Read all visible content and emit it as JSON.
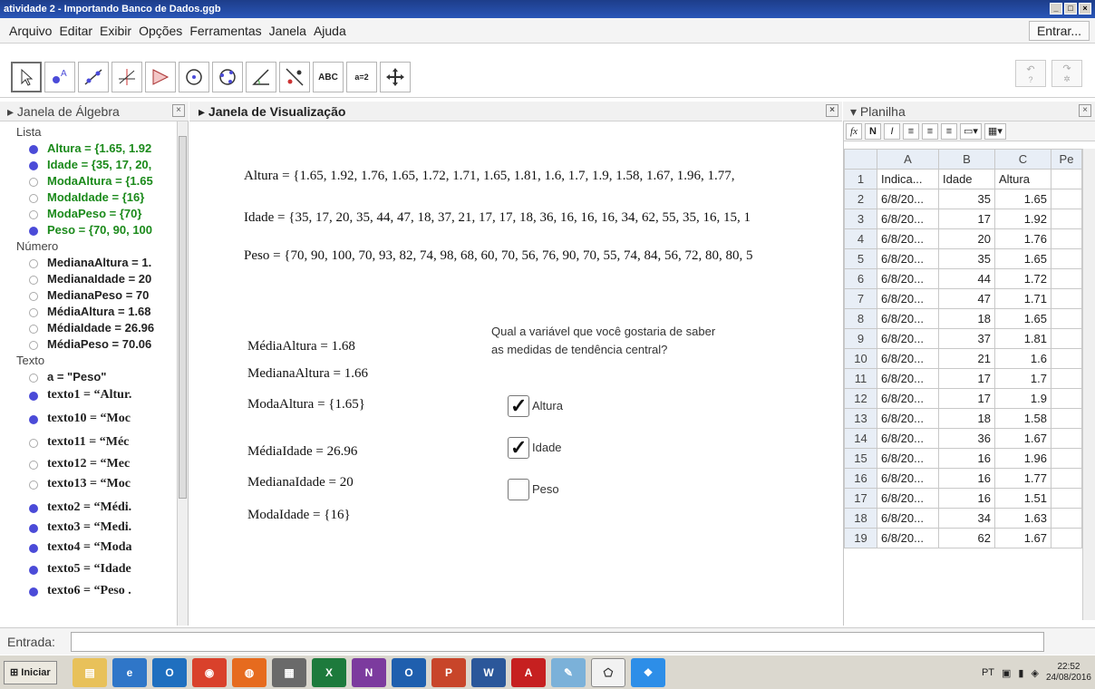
{
  "window": {
    "title": "atividade 2 - Importando Banco de Dados.ggb"
  },
  "menu": {
    "items": [
      "Arquivo",
      "Editar",
      "Exibir",
      "Opções",
      "Ferramentas",
      "Janela",
      "Ajuda"
    ],
    "signin": "Entrar..."
  },
  "toolbar": {
    "tools": [
      "move-tool-icon",
      "point-tool-icon",
      "line-tool-icon",
      "perpendicular-tool-icon",
      "polygon-tool-icon",
      "circle-tool-icon",
      "conic-tool-icon",
      "angle-tool-icon",
      "reflect-tool-icon",
      "text-tool-icon",
      "slider-tool-icon",
      "move-view-tool-icon"
    ],
    "text_label": "ABC",
    "slider_label": "a=2"
  },
  "panels": {
    "algebra_title": "Janela de Álgebra",
    "graphics_title": "Janela de Visualização",
    "sheet_title": "Planilha"
  },
  "algebra": {
    "cat_list": "Lista",
    "cat_number": "Número",
    "cat_text": "Texto",
    "lista": [
      "Altura = {1.65, 1.92",
      "Idade = {35, 17, 20,",
      "ModaAltura = {1.65",
      "ModaIdade = {16}",
      "ModaPeso = {70}",
      "Peso = {70, 90, 100"
    ],
    "numero": [
      "MedianaAltura = 1.",
      "MedianaIdade = 20",
      "MedianaPeso = 70",
      "MédiaAltura = 1.68",
      "MédiaIdade = 26.96",
      "MédiaPeso = 70.06"
    ],
    "texto": [
      "a = \"Peso\"",
      "texto1  =  “Altur.",
      "texto10  =  “Moc",
      "texto11  =  “Méc",
      "texto12  =  “Mec",
      "texto13  =  “Moc",
      "texto2  =  “Médi.",
      "texto3  =  “Medi.",
      "texto4  =  “Moda",
      "texto5  =  “Idade",
      "texto6  =  “Peso ."
    ]
  },
  "graphics": {
    "altura_list": "Altura  =  {1.65, 1.92, 1.76, 1.65, 1.72, 1.71, 1.65, 1.81, 1.6, 1.7, 1.9, 1.58, 1.67, 1.96, 1.77,",
    "idade_list": "Idade  =  {35, 17, 20, 35, 44, 47, 18, 37, 21, 17, 17, 18, 36, 16, 16, 16, 34, 62, 55, 35, 16, 15, 1",
    "peso_list": "Peso  =  {70, 90, 100, 70, 93, 82, 74, 98, 68, 60, 70, 56, 76, 90, 70, 55, 74, 84, 56, 72, 80, 80, 5",
    "media_altura": "MédiaAltura  =  1.68",
    "mediana_altura": "MedianaAltura  =  1.66",
    "moda_altura": "ModaAltura  =  {1.65}",
    "media_idade": "MédiaIdade  =  26.96",
    "mediana_idade": "MedianaIdade  =  20",
    "moda_idade": "ModaIdade  =  {16}",
    "question_line1": "Qual a variável que você gostaria de saber",
    "question_line2": "as medidas de tendência central?",
    "cb_altura": "Altura",
    "cb_idade": "Idade",
    "cb_peso": "Peso"
  },
  "sheet": {
    "cols": [
      "A",
      "B",
      "C",
      "Pe"
    ],
    "rows": [
      [
        "1",
        "Indica...",
        "Idade",
        "Altura"
      ],
      [
        "2",
        "6/8/20...",
        "35",
        "1.65"
      ],
      [
        "3",
        "6/8/20...",
        "17",
        "1.92"
      ],
      [
        "4",
        "6/8/20...",
        "20",
        "1.76"
      ],
      [
        "5",
        "6/8/20...",
        "35",
        "1.65"
      ],
      [
        "6",
        "6/8/20...",
        "44",
        "1.72"
      ],
      [
        "7",
        "6/8/20...",
        "47",
        "1.71"
      ],
      [
        "8",
        "6/8/20...",
        "18",
        "1.65"
      ],
      [
        "9",
        "6/8/20...",
        "37",
        "1.81"
      ],
      [
        "10",
        "6/8/20...",
        "21",
        "1.6"
      ],
      [
        "11",
        "6/8/20...",
        "17",
        "1.7"
      ],
      [
        "12",
        "6/8/20...",
        "17",
        "1.9"
      ],
      [
        "13",
        "6/8/20...",
        "18",
        "1.58"
      ],
      [
        "14",
        "6/8/20...",
        "36",
        "1.67"
      ],
      [
        "15",
        "6/8/20...",
        "16",
        "1.96"
      ],
      [
        "16",
        "6/8/20...",
        "16",
        "1.77"
      ],
      [
        "17",
        "6/8/20...",
        "16",
        "1.51"
      ],
      [
        "18",
        "6/8/20...",
        "34",
        "1.63"
      ],
      [
        "19",
        "6/8/20...",
        "62",
        "1.67"
      ]
    ]
  },
  "inputbar": {
    "label": "Entrada:"
  },
  "taskbar": {
    "start": "Iniciar",
    "lang": "PT",
    "time": "22:52",
    "date": "24/08/2016"
  },
  "colors": {
    "accent_green": "#1b8a1b",
    "dot_blue": "#4b4bd8"
  }
}
